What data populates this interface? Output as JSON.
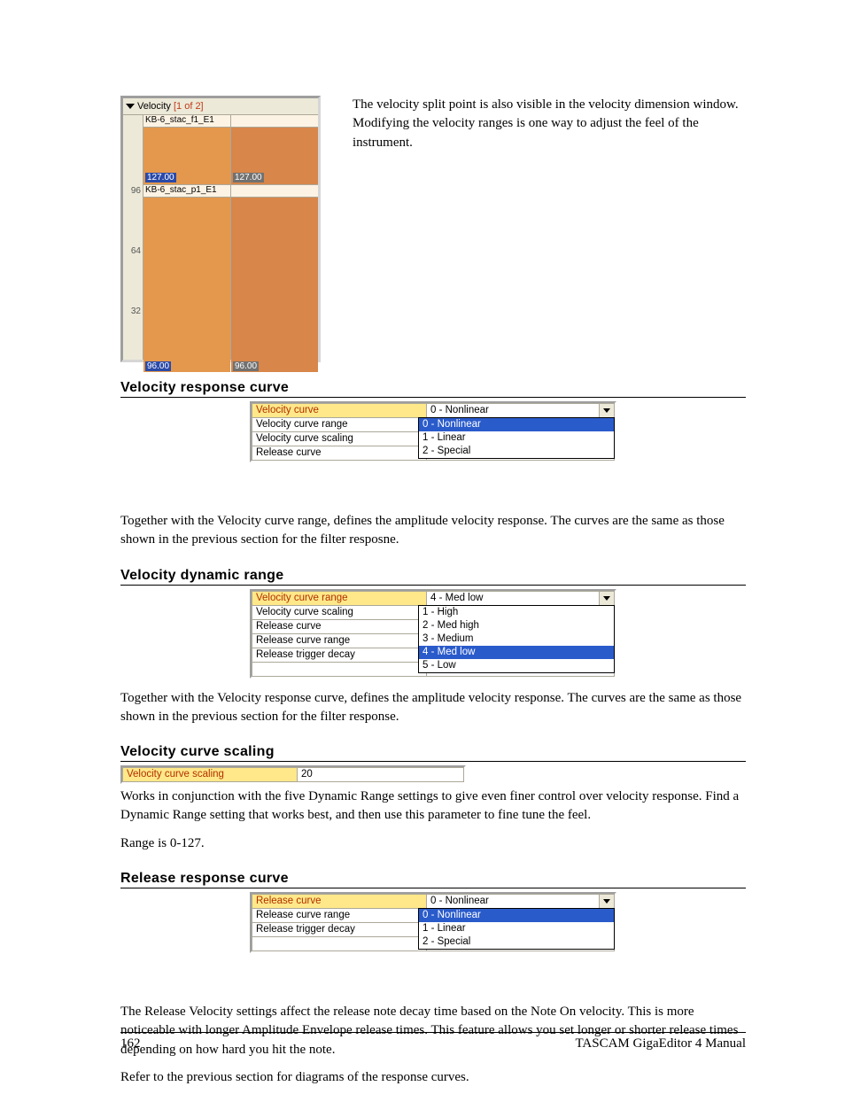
{
  "velocity_window": {
    "title_label": "Velocity",
    "title_count": "[1 of 2]",
    "axis_ticks": [
      "96",
      "64",
      "32"
    ],
    "cols": [
      {
        "sample_top": "KB-6_stac_f1_E1",
        "val_top": "127.00",
        "sample_bot": "KB-6_stac_p1_E1",
        "val_bot": "96.00",
        "selected": true
      },
      {
        "sample_top": "",
        "val_top": "127.00",
        "sample_bot": "",
        "val_bot": "96.00",
        "selected": false
      }
    ]
  },
  "intro_text": "The velocity split point is also visible in the velocity dimension window.  Modifying the velocity ranges is one way to adjust the feel of the instrument.",
  "sections": {
    "vrc": {
      "heading": "Velocity response curve",
      "rows": [
        {
          "label": "Velocity curve",
          "value": "0 - Nonlinear",
          "sel": true,
          "dd": true
        },
        {
          "label": "Velocity curve range",
          "value": ""
        },
        {
          "label": "Velocity curve scaling",
          "value": ""
        },
        {
          "label": "Release curve",
          "value": ""
        }
      ],
      "dropdown": {
        "items": [
          "0 - Nonlinear",
          "1 - Linear",
          "2 - Special"
        ],
        "selected_index": 0
      },
      "text": "Together with the Velocity curve range, defines the amplitude velocity response.  The curves are the same as those shown in the previous section for the filter resposne."
    },
    "vdr": {
      "heading": "Velocity dynamic range",
      "rows": [
        {
          "label": "Velocity curve range",
          "value": "4 - Med low",
          "sel": true,
          "dd": true
        },
        {
          "label": "Velocity curve scaling",
          "value": ""
        },
        {
          "label": "Release curve",
          "value": ""
        },
        {
          "label": "Release curve range",
          "value": ""
        },
        {
          "label": "Release trigger decay",
          "value": ""
        }
      ],
      "dropdown": {
        "items": [
          "1 - High",
          "2 - Med high",
          "3 - Medium",
          "4 - Med low",
          "5 - Low"
        ],
        "selected_index": 3
      },
      "text": "Together with the Velocity response curve, defines the amplitude velocity response.  The curves are the same as those shown in the previous section for the filter response."
    },
    "vcs": {
      "heading": "Velocity curve scaling",
      "rows": [
        {
          "label": "Velocity curve scaling",
          "value": "20",
          "sel": true
        }
      ],
      "text1": "Works in conjunction with the five Dynamic Range settings to give even finer control over velocity response.  Find a Dynamic Range setting that works best, and then use this parameter to fine tune the feel.",
      "text2": "Range is 0-127."
    },
    "rrc": {
      "heading": "Release response curve",
      "rows": [
        {
          "label": "Release curve",
          "value": "0 - Nonlinear",
          "sel": true,
          "dd": true
        },
        {
          "label": "Release curve range",
          "value": ""
        },
        {
          "label": "Release trigger decay",
          "value": ""
        }
      ],
      "dropdown": {
        "items": [
          "0 - Nonlinear",
          "1 - Linear",
          "2 - Special"
        ],
        "selected_index": 0
      },
      "text1": "The Release Velocity settings affect the release note decay time based on the Note On velocity. This is more noticeable with longer Amplitude Envelope release times. This feature allows you set longer or shorter release times depending on how hard you hit the note.",
      "text2": "Refer to the previous section for diagrams of the response curves."
    }
  },
  "footer": {
    "page": "162",
    "title": "TASCAM GigaEditor 4 Manual"
  }
}
